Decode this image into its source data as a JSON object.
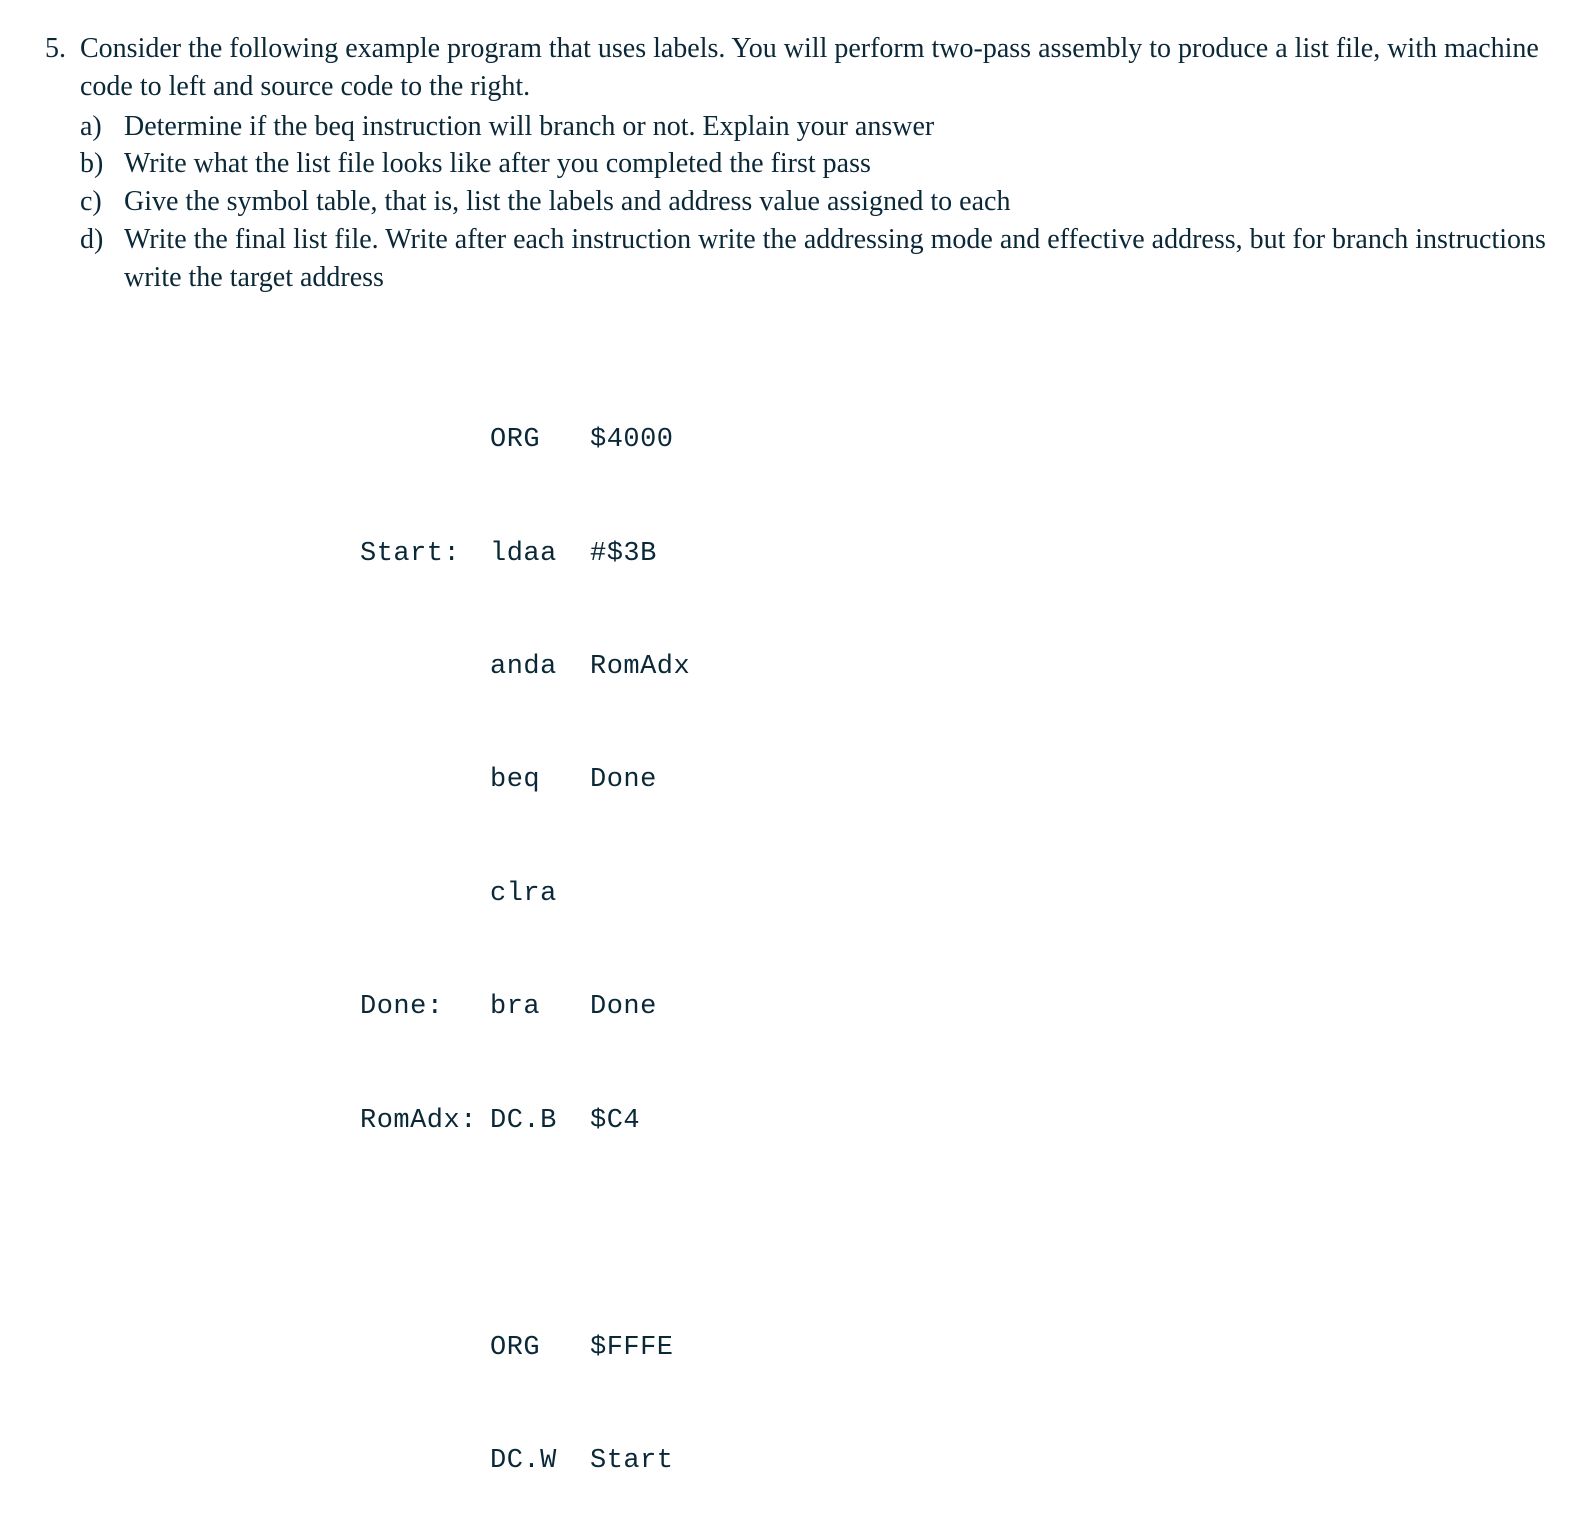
{
  "question": {
    "number": "5.",
    "intro": "Consider the following example program that uses labels. You will perform two-pass assembly to produce a list file, with machine code to left and source code to the right.",
    "subitems": [
      {
        "label": "a)",
        "text": "Determine if the beq instruction will branch or not. Explain your answer"
      },
      {
        "label": "b)",
        "text": "Write what the list file looks like after you completed the first pass"
      },
      {
        "label": "c)",
        "text": "Give the symbol table, that is, list the labels and address value assigned to each"
      },
      {
        "label": "d)",
        "text": "Write the final list file. Write after each instruction write the addressing mode and effective address, but for branch instructions write the target address"
      }
    ]
  },
  "code": {
    "lines": [
      {
        "label": "",
        "mnemonic": "ORG",
        "operand": "$4000"
      },
      {
        "label": "Start:",
        "mnemonic": "ldaa",
        "operand": "#$3B"
      },
      {
        "label": "",
        "mnemonic": "anda",
        "operand": "RomAdx"
      },
      {
        "label": "",
        "mnemonic": "beq",
        "operand": "Done"
      },
      {
        "label": "",
        "mnemonic": "clra",
        "operand": ""
      },
      {
        "label": "Done:",
        "mnemonic": "bra",
        "operand": "Done"
      },
      {
        "label": "RomAdx:",
        "mnemonic": "DC.B",
        "operand": "$C4"
      },
      {
        "gap": true
      },
      {
        "label": "",
        "mnemonic": "ORG",
        "operand": "$FFFE"
      },
      {
        "label": "",
        "mnemonic": "DC.W",
        "operand": "Start"
      }
    ]
  }
}
